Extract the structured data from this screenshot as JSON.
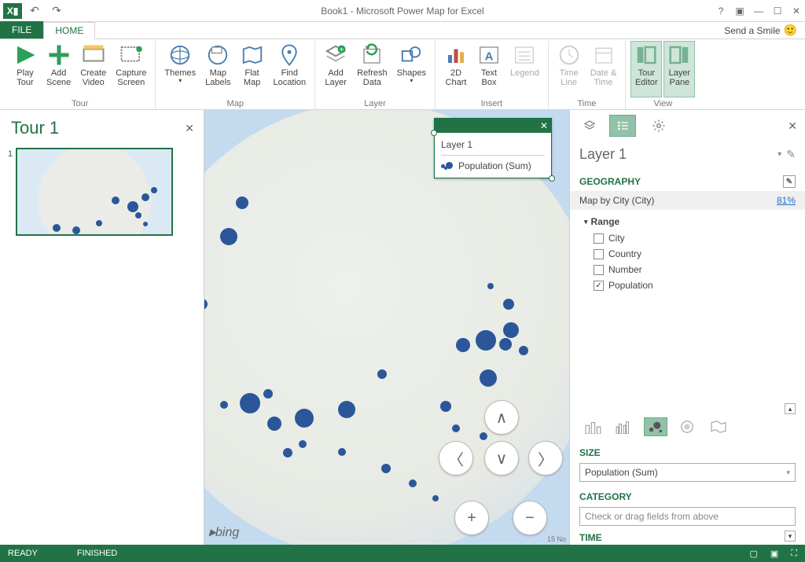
{
  "window": {
    "title": "Book1 - Microsoft Power Map for Excel",
    "send_smile": "Send a Smile"
  },
  "tabs": {
    "file": "FILE",
    "home": "HOME"
  },
  "ribbon": {
    "tour": {
      "label": "Tour",
      "play_tour": "Play\nTour",
      "add_scene": "Add\nScene",
      "create_video": "Create\nVideo",
      "capture_screen": "Capture\nScreen"
    },
    "map": {
      "label": "Map",
      "themes": "Themes",
      "map_labels": "Map\nLabels",
      "flat_map": "Flat\nMap",
      "find_location": "Find\nLocation"
    },
    "layer": {
      "label": "Layer",
      "add_layer": "Add\nLayer",
      "refresh_data": "Refresh\nData",
      "shapes": "Shapes"
    },
    "insert": {
      "label": "Insert",
      "chart_2d": "2D\nChart",
      "text_box": "Text\nBox",
      "legend": "Legend"
    },
    "time": {
      "label": "Time",
      "time_line": "Time\nLine",
      "date_time": "Date &\nTime"
    },
    "view": {
      "label": "View",
      "tour_editor": "Tour\nEditor",
      "layer_pane": "Layer\nPane"
    }
  },
  "tour_panel": {
    "title": "Tour 1",
    "scene_index": "1"
  },
  "map_legend": {
    "layer": "Layer 1",
    "series": "Population (Sum)"
  },
  "map": {
    "provider": "bing",
    "attribution": "15 No"
  },
  "layer_pane": {
    "layer_title": "Layer 1",
    "geography": {
      "title": "GEOGRAPHY",
      "map_by": "Map by City (City)",
      "confidence": "81%",
      "range_label": "Range",
      "fields": {
        "city": "City",
        "country": "Country",
        "number": "Number",
        "population": "Population"
      }
    },
    "size": {
      "title": "SIZE",
      "value": "Population (Sum)"
    },
    "category": {
      "title": "CATEGORY",
      "placeholder": "Check or drag fields from above"
    },
    "time": {
      "title": "TIME"
    }
  },
  "statusbar": {
    "ready": "READY",
    "finished": "FINISHED"
  }
}
